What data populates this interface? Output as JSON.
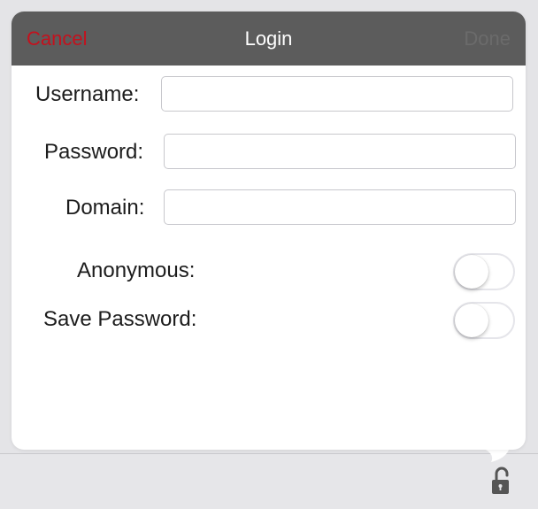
{
  "nav": {
    "cancel_label": "Cancel",
    "title": "Login",
    "done_label": "Done"
  },
  "form": {
    "username": {
      "label": "Username:",
      "value": "",
      "placeholder": ""
    },
    "password": {
      "label": "Password:",
      "value": "",
      "placeholder": ""
    },
    "domain": {
      "label": "Domain:",
      "value": "",
      "placeholder": ""
    },
    "anonymous": {
      "label": "Anonymous:",
      "state": "off"
    },
    "save_password": {
      "label": "Save Password:",
      "state": "off"
    }
  },
  "toolbar": {
    "lock_icon": "unlocked-padlock-icon"
  },
  "colors": {
    "navbar_bg": "#5c5c5c",
    "cancel": "#c4111d",
    "done_disabled": "#6b6b6b",
    "backdrop": "#e4e4e7"
  }
}
